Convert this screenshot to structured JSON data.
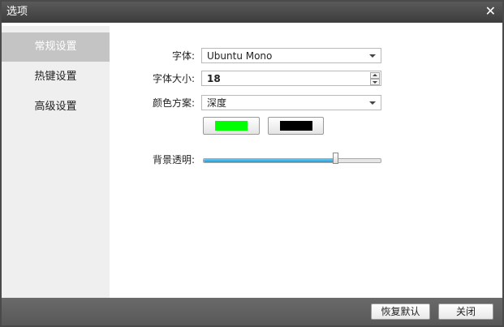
{
  "window": {
    "title": "选项"
  },
  "sidebar": {
    "items": [
      {
        "label": "常规设置",
        "active": true
      },
      {
        "label": "热键设置",
        "active": false
      },
      {
        "label": "高级设置",
        "active": false
      }
    ]
  },
  "general": {
    "font_label": "字体:",
    "font_value": "Ubuntu Mono",
    "font_size_label": "字体大小:",
    "font_size_value": "18",
    "color_scheme_label": "颜色方案:",
    "color_scheme_value": "深度",
    "foreground_color": "#00ff00",
    "background_color": "#000000",
    "opacity_label": "背景透明:",
    "opacity_value": 0.74
  },
  "footer": {
    "restore_label": "恢复默认",
    "close_label": "关闭"
  },
  "icons": {
    "close": "close-icon",
    "dropdown": "chevron-down-icon"
  }
}
